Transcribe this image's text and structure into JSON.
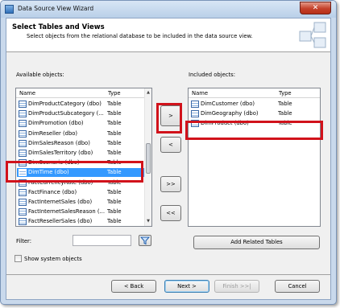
{
  "window": {
    "title": "Data Source View Wizard",
    "close_glyph": "✕"
  },
  "header": {
    "title": "Select Tables and Views",
    "subtitle": "Select objects from the relational database to be included in the data source view."
  },
  "available": {
    "label": "Available objects:",
    "columns": {
      "name": "Name",
      "type": "Type"
    },
    "rows": [
      {
        "name": "DimProductCategory (dbo)",
        "type": "Table"
      },
      {
        "name": "DimProductSubcategory (...",
        "type": "Table"
      },
      {
        "name": "DimPromotion (dbo)",
        "type": "Table"
      },
      {
        "name": "DimReseller (dbo)",
        "type": "Table"
      },
      {
        "name": "DimSalesReason (dbo)",
        "type": "Table"
      },
      {
        "name": "DimSalesTerritory (dbo)",
        "type": "Table"
      },
      {
        "name": "DimScenario (dbo)",
        "type": "Table"
      },
      {
        "name": "DimTime (dbo)",
        "type": "Table"
      },
      {
        "name": "FactCurrencyRate (dbo)",
        "type": "Table"
      },
      {
        "name": "FactFinance (dbo)",
        "type": "Table"
      },
      {
        "name": "FactInternetSales (dbo)",
        "type": "Table"
      },
      {
        "name": "FactInternetSalesReason (...",
        "type": "Table"
      },
      {
        "name": "FactResellerSales (dbo)",
        "type": "Table"
      }
    ],
    "selected_index": 7
  },
  "included": {
    "label": "Included objects:",
    "columns": {
      "name": "Name",
      "type": "Type"
    },
    "rows": [
      {
        "name": "DimCustomer (dbo)",
        "type": "Table"
      },
      {
        "name": "DimGeography (dbo)",
        "type": "Table"
      },
      {
        "name": "DimProduct (dbo)",
        "type": "Table"
      }
    ]
  },
  "move_buttons": {
    "add": ">",
    "remove": "<",
    "add_all": ">>",
    "remove_all": "<<"
  },
  "filter": {
    "label": "Filter:",
    "value": ""
  },
  "show_system": {
    "label": "Show system objects",
    "checked": false
  },
  "add_related": {
    "label": "Add Related Tables"
  },
  "footer": {
    "back": "< Back",
    "next": "Next >",
    "finish": "Finish >>|",
    "cancel": "Cancel"
  },
  "colors": {
    "highlight": "#d1121b",
    "selection": "#3399ff"
  },
  "icons": {
    "table": "table-icon",
    "filter": "funnel-icon",
    "scroll_up": "arrow-up-icon",
    "scroll_down": "arrow-down-icon"
  }
}
